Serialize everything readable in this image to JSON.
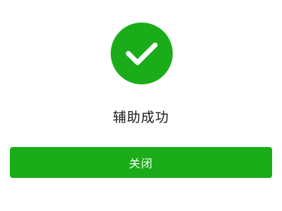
{
  "status": {
    "icon": "check-icon",
    "message": "辅助成功"
  },
  "actions": {
    "close_label": "关闭"
  },
  "colors": {
    "accent": "#1aad19",
    "background": "#ffffff",
    "text": "#1a1a1a",
    "button_text": "#ffffff"
  }
}
